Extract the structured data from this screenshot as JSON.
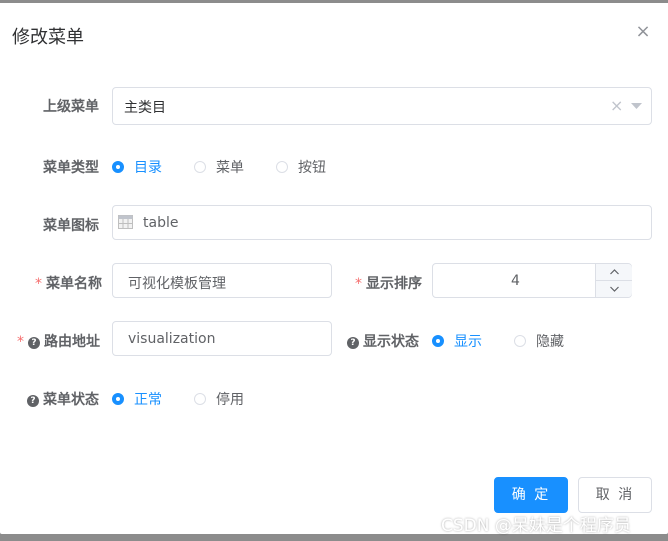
{
  "dialog": {
    "title": "修改菜单",
    "close_glyph": "×"
  },
  "form": {
    "parent_menu": {
      "label": "上级菜单",
      "value": "主类目",
      "clear_glyph": "×"
    },
    "menu_type": {
      "label": "菜单类型",
      "options": [
        "目录",
        "菜单",
        "按钮"
      ],
      "selected": "目录"
    },
    "menu_icon": {
      "label": "菜单图标",
      "value": "table",
      "icon": "table-icon"
    },
    "menu_name": {
      "required_mark": "*",
      "label": "菜单名称",
      "value": "可视化模板管理"
    },
    "display_order": {
      "required_mark": "*",
      "label": "显示排序",
      "value": "4"
    },
    "route_path": {
      "required_mark": "*",
      "help_glyph": "?",
      "label": "路由地址",
      "value": "visualization"
    },
    "display_status": {
      "help_glyph": "?",
      "label": "显示状态",
      "options": [
        "显示",
        "隐藏"
      ],
      "selected": "显示"
    },
    "menu_status": {
      "help_glyph": "?",
      "label": "菜单状态",
      "options": [
        "正常",
        "停用"
      ],
      "selected": "正常"
    }
  },
  "footer": {
    "confirm_label": "确 定",
    "cancel_label": "取 消"
  },
  "watermark": "CSDN @呆妹是个程序员",
  "colors": {
    "accent": "#1890ff",
    "required": "#f56c6c",
    "border": "#dcdfe6",
    "text": "#606266"
  }
}
